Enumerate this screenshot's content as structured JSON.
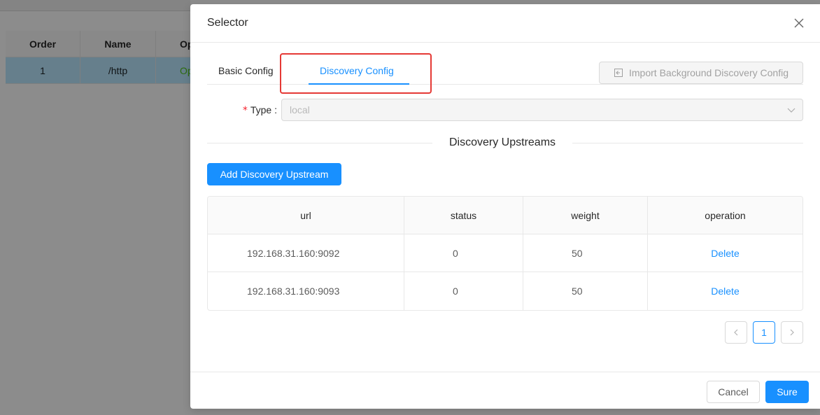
{
  "background": {
    "table": {
      "headers": [
        "Order",
        "Name",
        "Op"
      ],
      "rows": [
        {
          "order": "1",
          "name": "/http",
          "op": "Op"
        }
      ]
    }
  },
  "modal": {
    "title": "Selector",
    "tabs": [
      {
        "label": "Basic Config",
        "active": false
      },
      {
        "label": "Discovery Config",
        "active": true
      }
    ],
    "import_button": "Import Background Discovery Config",
    "type_field": {
      "label": "Type",
      "required_mark": "*",
      "value": "local"
    },
    "section_title": "Discovery Upstreams",
    "add_button": "Add Discovery Upstream",
    "table": {
      "headers": {
        "url": "url",
        "status": "status",
        "weight": "weight",
        "operation": "operation"
      },
      "rows": [
        {
          "url": "192.168.31.160:9092",
          "status": "0",
          "weight": "50",
          "operation": "Delete"
        },
        {
          "url": "192.168.31.160:9093",
          "status": "0",
          "weight": "50",
          "operation": "Delete"
        }
      ]
    },
    "pagination": {
      "current": "1"
    },
    "footer": {
      "cancel": "Cancel",
      "sure": "Sure"
    }
  },
  "colors": {
    "primary": "#1890ff",
    "highlight": "#e53935"
  }
}
